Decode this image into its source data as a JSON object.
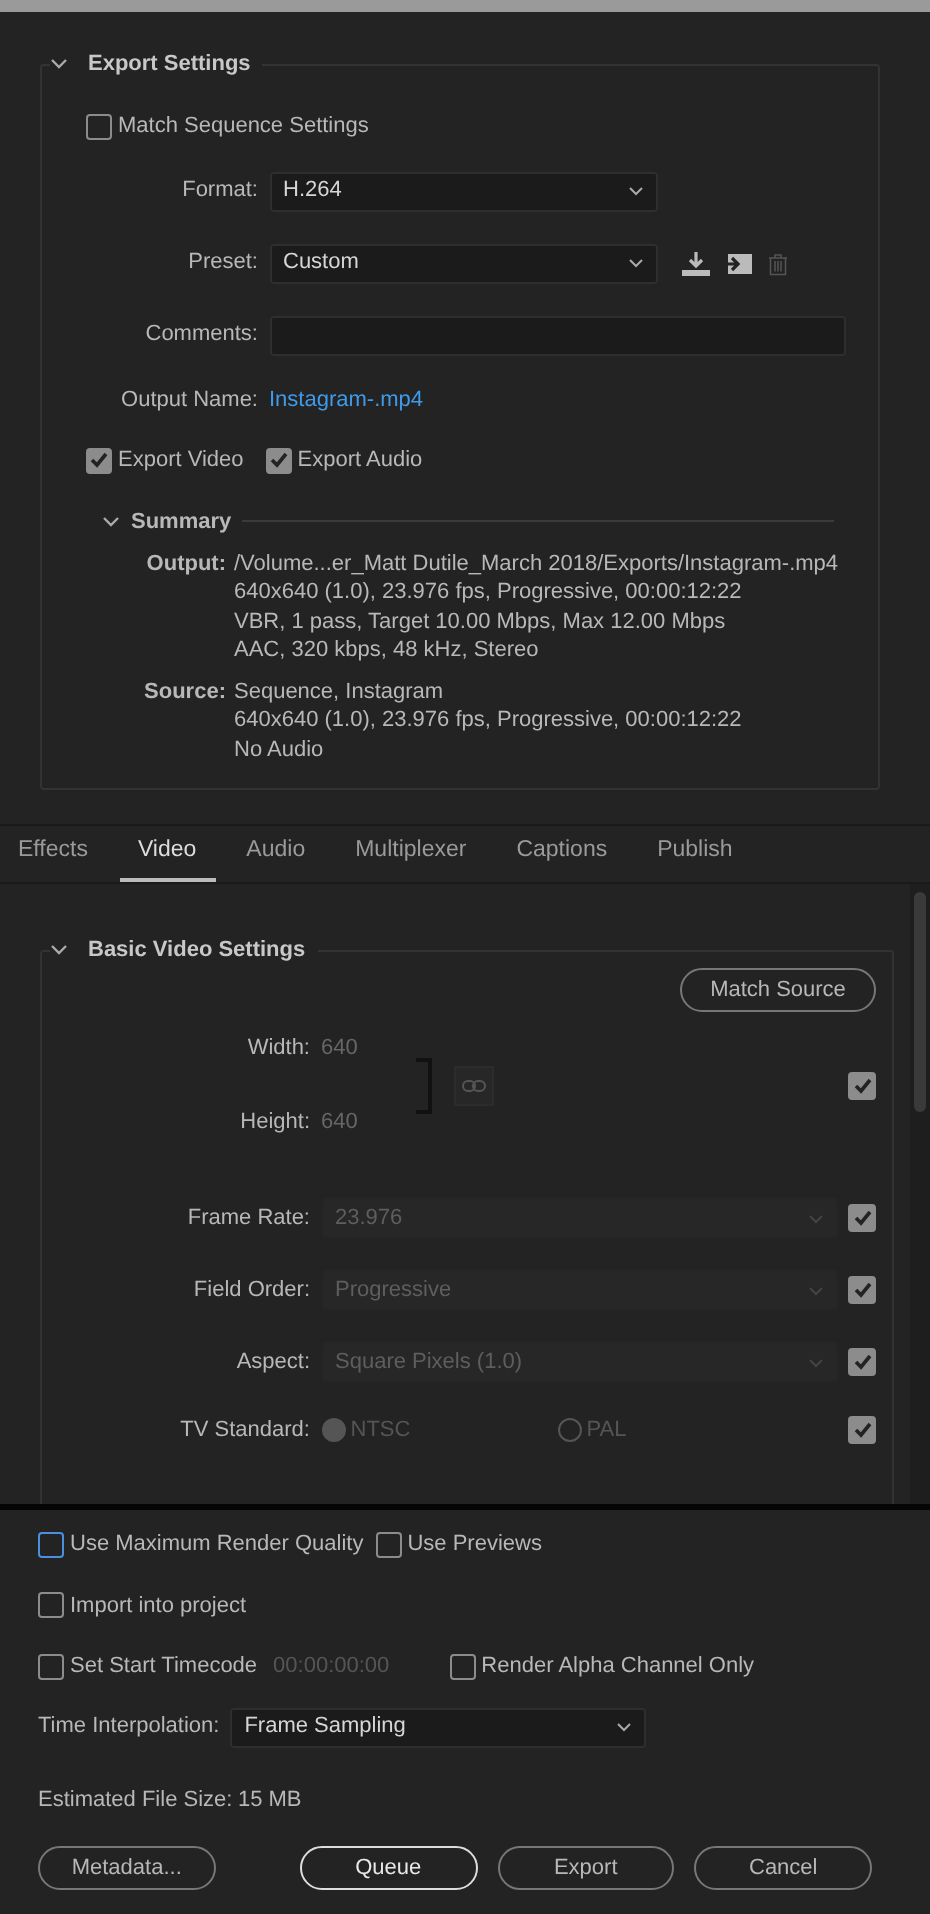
{
  "export_settings": {
    "title": "Export Settings",
    "expanded": true,
    "match_sequence": {
      "label": "Match Sequence Settings",
      "checked": false
    },
    "format": {
      "label": "Format:",
      "value": "H.264"
    },
    "preset": {
      "label": "Preset:",
      "value": "Custom"
    },
    "comments": {
      "label": "Comments:"
    },
    "output_name": {
      "label": "Output Name:",
      "value": "Instagram-.mp4"
    },
    "export_video": {
      "label": "Export Video",
      "checked": true
    },
    "export_audio": {
      "label": "Export Audio",
      "checked": true
    },
    "summary": {
      "title": "Summary",
      "expanded": true,
      "entries": [
        {
          "label": "Output:",
          "lines": [
            "/Volume...er_Matt Dutile_March 2018/Exports/Instagram-.mp4",
            "640x640 (1.0), 23.976 fps, Progressive, 00:00:12:22",
            "VBR, 1 pass, Target 10.00 Mbps, Max 12.00 Mbps",
            "AAC, 320 kbps, 48 kHz, Stereo"
          ]
        },
        {
          "label": "Source:",
          "lines": [
            "Sequence, Instagram",
            "640x640 (1.0), 23.976 fps, Progressive, 00:00:12:22",
            "No Audio"
          ]
        }
      ]
    }
  },
  "tabs": [
    {
      "label": "Effects",
      "selected": false
    },
    {
      "label": "Video",
      "selected": true
    },
    {
      "label": "Audio",
      "selected": false
    },
    {
      "label": "Multiplexer",
      "selected": false
    },
    {
      "label": "Captions",
      "selected": false
    },
    {
      "label": "Publish",
      "selected": false
    }
  ],
  "basic_video": {
    "title": "Basic Video Settings",
    "expanded": true,
    "match_source": "Match Source",
    "width": {
      "label": "Width:",
      "value": "640"
    },
    "height": {
      "label": "Height:",
      "value": "640"
    },
    "dimensions_checked": true,
    "rows": [
      {
        "kind": "dropdown",
        "label": "Frame Rate:",
        "value": "23.976",
        "checked": true
      },
      {
        "kind": "dropdown",
        "label": "Field Order:",
        "value": "Progressive",
        "checked": true
      },
      {
        "kind": "dropdown",
        "label": "Aspect:",
        "value": "Square Pixels (1.0)",
        "checked": true
      },
      {
        "kind": "radio",
        "label": "TV Standard:",
        "options": [
          {
            "label": "NTSC",
            "selected": true
          },
          {
            "label": "PAL",
            "selected": false
          }
        ],
        "checked": true
      }
    ]
  },
  "options": [
    [
      {
        "label": "Use Maximum Render Quality",
        "checked": false,
        "focused": true
      },
      {
        "label": "Use Previews",
        "checked": false,
        "focused": false
      }
    ],
    [
      {
        "label": "Import into project",
        "checked": false,
        "focused": false
      }
    ],
    [
      {
        "label": "Set Start Timecode",
        "checked": false,
        "focused": false,
        "timecode": "00:00:00:00"
      },
      {
        "label": "Render Alpha Channel Only",
        "checked": false,
        "focused": false
      }
    ]
  ],
  "time_interpolation": {
    "label": "Time Interpolation:",
    "value": "Frame Sampling"
  },
  "estimated_file_size": {
    "label": "Estimated File Size:",
    "value": "15 MB"
  },
  "buttons": [
    {
      "label": "Metadata...",
      "default": false
    },
    {
      "label": "Queue",
      "default": true
    },
    {
      "label": "Export",
      "default": false
    },
    {
      "label": "Cancel",
      "default": false
    }
  ]
}
